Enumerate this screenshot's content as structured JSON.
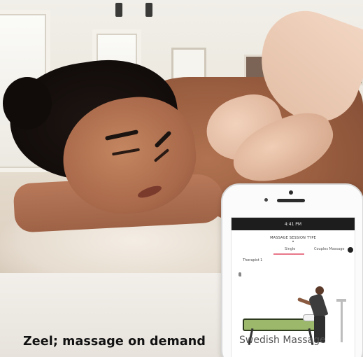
{
  "caption": "Zeel; massage on demand",
  "phone": {
    "status_time": "4:41 PM",
    "screen_title": "MASSAGE SESSION TYPE",
    "tabs": [
      "Single",
      "Couples Massage"
    ],
    "therapist_label": "Therapist 1",
    "massage_type": "Swedish Massage"
  },
  "colors": {
    "tab_underline": "#e8778b",
    "caption_text": "#111111"
  }
}
